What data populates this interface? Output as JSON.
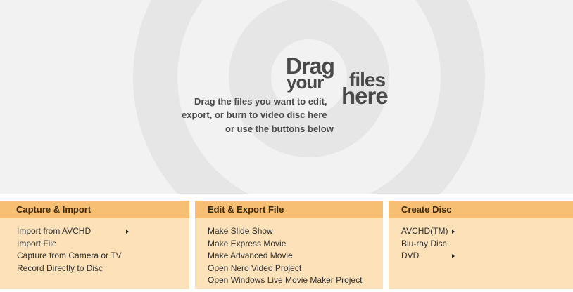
{
  "drop_zone": {
    "hero": {
      "line1": "Drag",
      "line2": "your",
      "line3": "files",
      "line4": "here"
    },
    "instructions": [
      "Drag the files you want to edit,",
      "export, or burn to video disc here",
      "or use the buttons below"
    ]
  },
  "panels": {
    "capture": {
      "title": "Capture & Import",
      "items": [
        {
          "label": "Import from AVCHD",
          "has_submenu": true
        },
        {
          "label": "Import File",
          "has_submenu": false
        },
        {
          "label": "Capture from Camera or TV",
          "has_submenu": false
        },
        {
          "label": "Record Directly to Disc",
          "has_submenu": false
        }
      ]
    },
    "edit": {
      "title": "Edit & Export File",
      "items": [
        {
          "label": "Make Slide Show"
        },
        {
          "label": "Make Express Movie"
        },
        {
          "label": "Make Advanced Movie"
        },
        {
          "label": "Open Nero Video Project"
        },
        {
          "label": "Open Windows Live Movie Maker Project"
        }
      ]
    },
    "disc": {
      "title": "Create Disc",
      "items": [
        {
          "label": "AVCHD(TM)",
          "has_submenu": true
        },
        {
          "label": "Blu-ray Disc",
          "has_submenu": false
        },
        {
          "label": "DVD",
          "has_submenu": true
        }
      ]
    }
  },
  "colors": {
    "header_bg": "#f6bf74",
    "panel_bg": "#fde1b8",
    "drop_bg": "#f2f2f2",
    "ring": "#e6e6e6"
  },
  "icons": {
    "submenu": "submenu-arrow-icon"
  }
}
